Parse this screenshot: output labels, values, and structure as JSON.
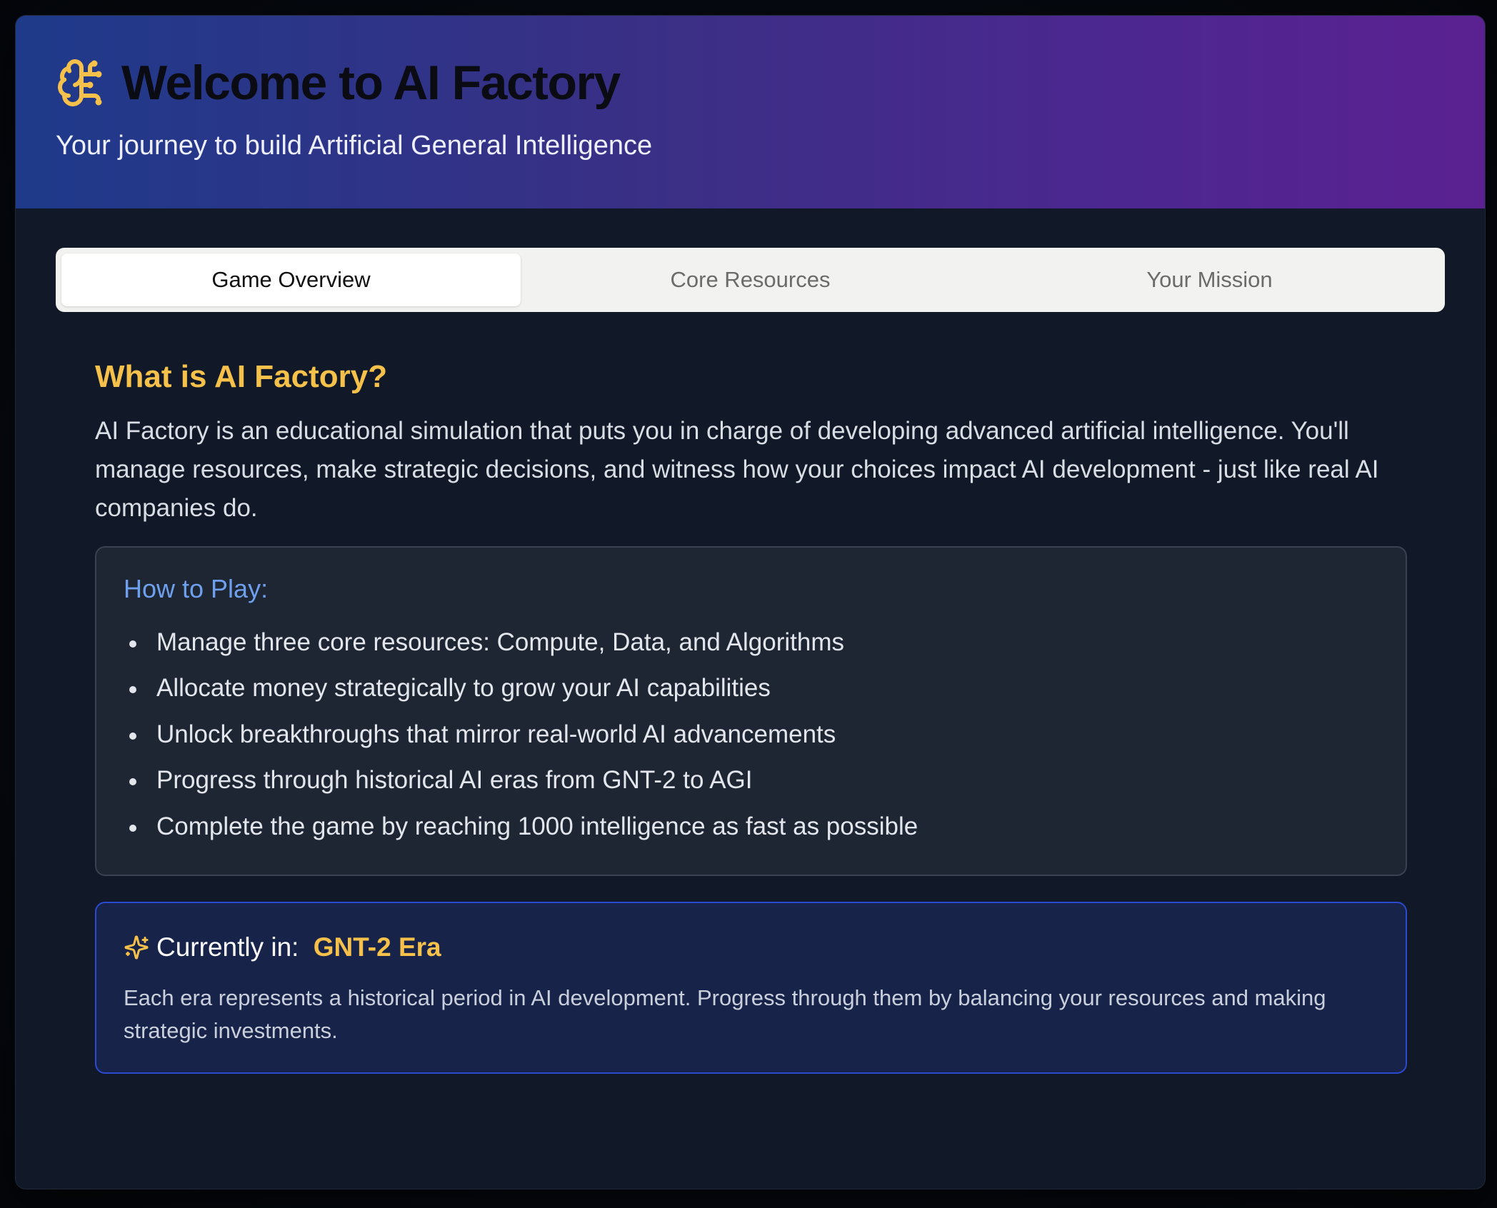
{
  "header": {
    "title": "Welcome to AI Factory",
    "subtitle": "Your journey to build Artificial General Intelligence",
    "icon": "brain-icon",
    "accent_color": "#f6c14a"
  },
  "tabs": [
    {
      "label": "Game Overview",
      "active": true
    },
    {
      "label": "Core Resources",
      "active": false
    },
    {
      "label": "Your Mission",
      "active": false
    }
  ],
  "overview": {
    "heading": "What is AI Factory?",
    "intro": "AI Factory is an educational simulation that puts you in charge of developing advanced artificial intelligence. You'll manage resources, make strategic decisions, and witness how your choices impact AI development - just like real AI companies do.",
    "how_to_play": {
      "title": "How to Play:",
      "items": [
        "Manage three core resources: Compute, Data, and Algorithms",
        "Allocate money strategically to grow your AI capabilities",
        "Unlock breakthroughs that mirror real-world AI advancements",
        "Progress through historical AI eras from GNT-2 to AGI",
        "Complete the game by reaching 1000 intelligence as fast as possible"
      ]
    },
    "era": {
      "icon": "sparkles-icon",
      "label": "Currently in: ",
      "name": "GNT-2 Era",
      "description": "Each era represents a historical period in AI development. Progress through them by balancing your resources and making strategic investments."
    }
  }
}
